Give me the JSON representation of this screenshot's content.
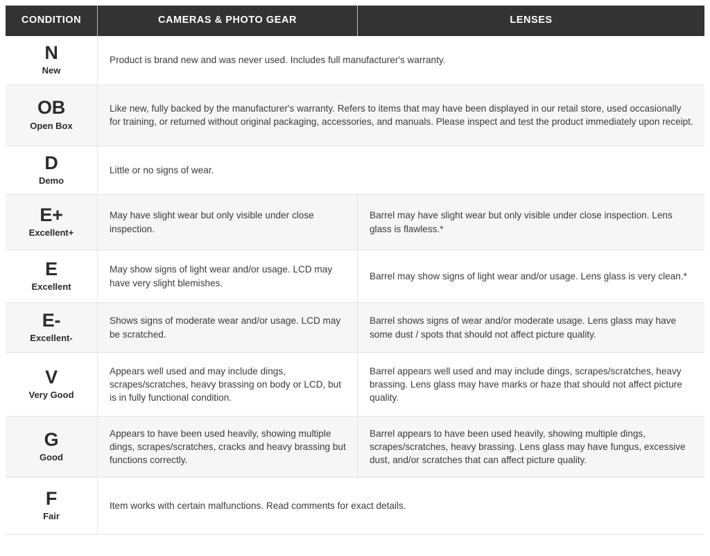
{
  "table": {
    "headers": {
      "condition": "CONDITION",
      "cameras": "CAMERAS & PHOTO GEAR",
      "lenses": "LENSES"
    },
    "colors": {
      "header_background": "#333333",
      "header_text": "#ffffff",
      "row_background": "#ffffff",
      "row_background_alt": "#f6f6f6",
      "border": "#e4e4e4",
      "body_text": "#3a3a3a"
    },
    "rows": [
      {
        "code": "N",
        "name": "New",
        "spans_columns": true,
        "description": "Product is brand new and was never used. Includes full manufacturer's warranty.",
        "cameras": "",
        "lenses": ""
      },
      {
        "code": "OB",
        "name": "Open Box",
        "spans_columns": true,
        "description": "Like new, fully backed by the manufacturer's warranty. Refers to items that may have been displayed in our retail store, used occasionally for training, or returned without original packaging, accessories, and manuals. Please inspect and test the product immediately upon receipt.",
        "cameras": "",
        "lenses": ""
      },
      {
        "code": "D",
        "name": "Demo",
        "spans_columns": true,
        "description": "Little or no signs of wear.",
        "cameras": "",
        "lenses": ""
      },
      {
        "code": "E+",
        "name": "Excellent+",
        "spans_columns": false,
        "description": "",
        "cameras": "May have slight wear but only visible under close inspection.",
        "lenses": "Barrel may have slight wear but only visible under close inspection. Lens glass is flawless.*"
      },
      {
        "code": "E",
        "name": "Excellent",
        "spans_columns": false,
        "description": "",
        "cameras": "May show signs of light wear and/or usage. LCD may have very slight blemishes.",
        "lenses": "Barrel may show signs of light wear and/or usage. Lens glass is very clean.*"
      },
      {
        "code": "E-",
        "name": "Excellent-",
        "spans_columns": false,
        "description": "",
        "cameras": "Shows signs of moderate wear and/or usage. LCD may be scratched.",
        "lenses": "Barrel shows signs of wear and/or moderate usage. Lens glass may have some dust / spots that should not affect picture quality."
      },
      {
        "code": "V",
        "name": "Very Good",
        "spans_columns": false,
        "description": "",
        "cameras": "Appears well used and may include dings, scrapes/scratches, heavy brassing on body or LCD, but is in fully functional condition.",
        "lenses": "Barrel appears well used and may include dings, scrapes/scratches, heavy brassing. Lens glass may have marks or haze that should not affect picture quality."
      },
      {
        "code": "G",
        "name": "Good",
        "spans_columns": false,
        "description": "",
        "cameras": "Appears to have been used heavily, showing multiple dings, scrapes/scratches, cracks and heavy brassing but functions correctly.",
        "lenses": "Barrel appears to have been used heavily, showing multiple dings, scrapes/scratches, heavy brassing. Lens glass may have fungus, excessive dust, and/or scratches that can affect picture quality."
      },
      {
        "code": "F",
        "name": "Fair",
        "spans_columns": true,
        "description": "Item works with certain malfunctions. Read comments for exact details.",
        "cameras": "",
        "lenses": ""
      }
    ]
  }
}
